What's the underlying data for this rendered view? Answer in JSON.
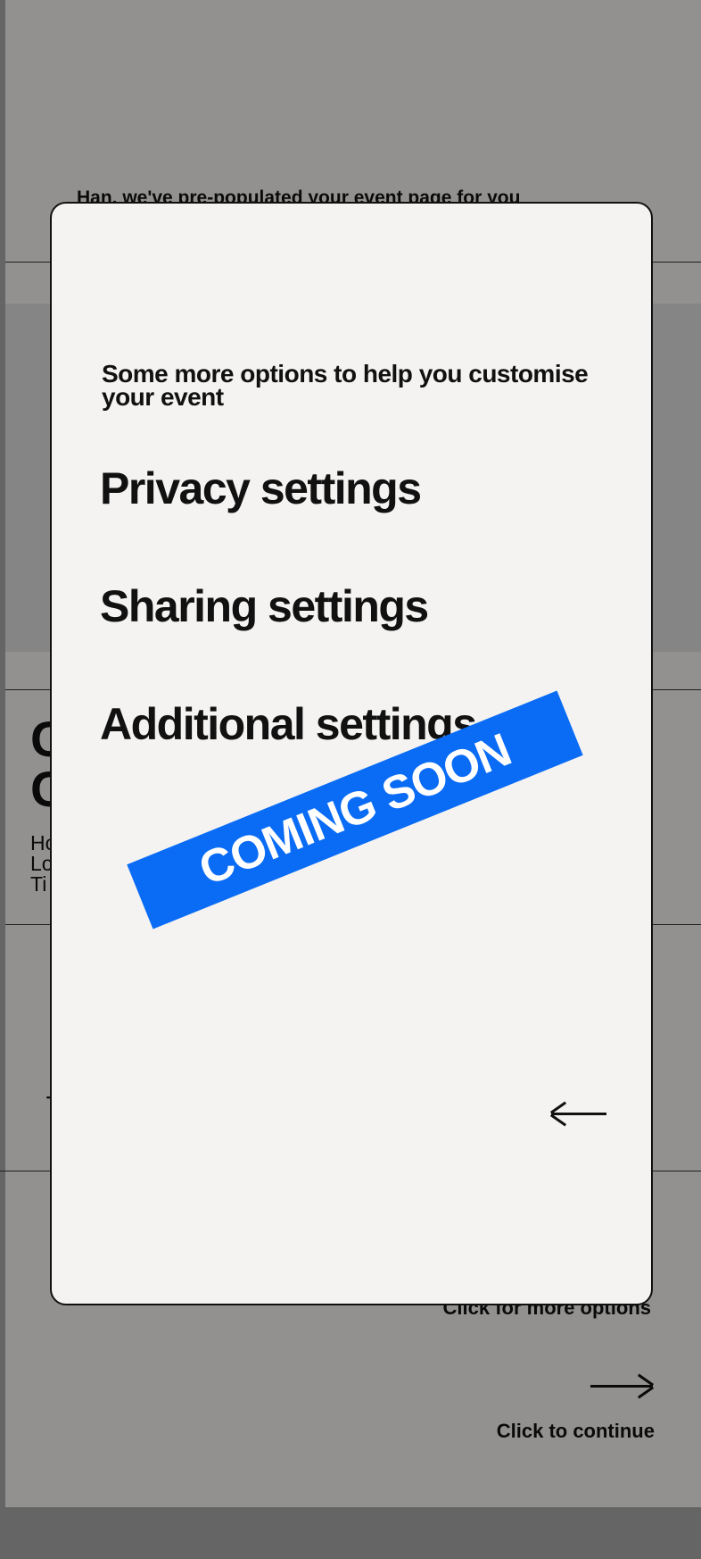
{
  "background": {
    "header_text": "Han, we've pre-populated your event page for you",
    "big_letters": [
      "C",
      "C"
    ],
    "small_letters": [
      "Ho",
      "Lo",
      "Ti"
    ],
    "side_letter": "T",
    "more_options_label": "Click for more options",
    "continue_label": "Click to continue"
  },
  "modal": {
    "subtitle": "Some more options to help you customise your event",
    "options": [
      "Privacy settings",
      "Sharing settings",
      "Additional settings"
    ],
    "banner": "COMING SOON",
    "back_icon": "arrow-left-icon"
  },
  "colors": {
    "accent": "#0a6cf5",
    "modal_bg": "#f4f3f1",
    "text": "#111111"
  }
}
